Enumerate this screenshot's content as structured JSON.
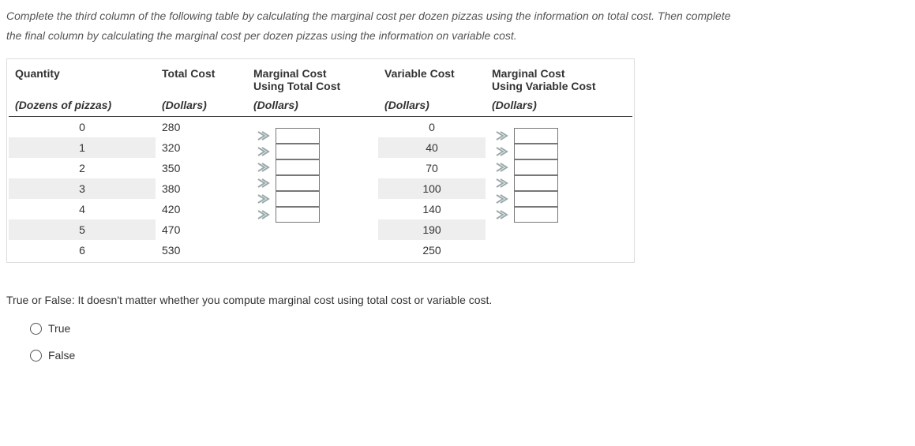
{
  "instructions_line1": "Complete the third column of the following table by calculating the marginal cost per dozen pizzas using the information on total cost. Then complete",
  "instructions_line2": "the final column by calculating the marginal cost per dozen pizzas using the information on variable cost.",
  "headers": {
    "qty": "Quantity",
    "tc": "Total Cost",
    "mc1_a": "Marginal Cost",
    "mc1_b": "Using Total Cost",
    "vc": "Variable Cost",
    "mc2_a": "Marginal Cost",
    "mc2_b": "Using Variable Cost"
  },
  "units": {
    "qty": "(Dozens of pizzas)",
    "tc": "(Dollars)",
    "mc1": "(Dollars)",
    "vc": "(Dollars)",
    "mc2": "(Dollars)"
  },
  "rows": [
    {
      "qty": "0",
      "tc": "280",
      "vc": "0"
    },
    {
      "qty": "1",
      "tc": "320",
      "vc": "40"
    },
    {
      "qty": "2",
      "tc": "350",
      "vc": "70"
    },
    {
      "qty": "3",
      "tc": "380",
      "vc": "100"
    },
    {
      "qty": "4",
      "tc": "420",
      "vc": "140"
    },
    {
      "qty": "5",
      "tc": "470",
      "vc": "190"
    },
    {
      "qty": "6",
      "tc": "530",
      "vc": "250"
    }
  ],
  "mc_inputs": [
    "",
    "",
    "",
    "",
    "",
    ""
  ],
  "tf_question": "True or False: It doesn't matter whether you compute marginal cost using total cost or variable cost.",
  "tf_options": {
    "true": "True",
    "false": "False"
  }
}
